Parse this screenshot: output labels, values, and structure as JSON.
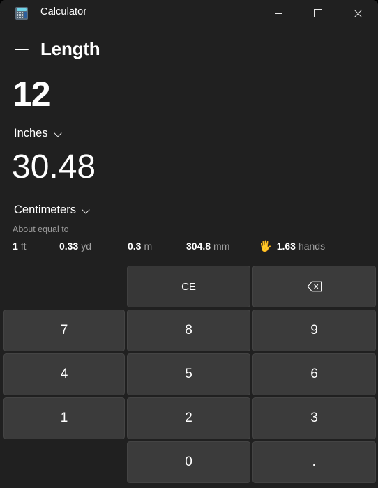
{
  "window": {
    "title": "Calculator",
    "app_icon": "calculator-icon",
    "controls": {
      "minimize": "minimize-icon",
      "maximize": "maximize-icon",
      "close": "close-icon"
    }
  },
  "header": {
    "menu_icon": "hamburger-menu-icon",
    "mode_title": "Length"
  },
  "converter": {
    "from": {
      "value": "12",
      "unit": "Inches",
      "chevron": "chevron-down-icon"
    },
    "to": {
      "value": "30.48",
      "unit": "Centimeters",
      "chevron": "chevron-down-icon"
    },
    "about_label": "About equal to",
    "equivalents": [
      {
        "number": "1",
        "unit": "ft",
        "icon": ""
      },
      {
        "number": "0.33",
        "unit": "yd",
        "icon": ""
      },
      {
        "number": "0.3",
        "unit": "m",
        "icon": ""
      },
      {
        "number": "304.8",
        "unit": "mm",
        "icon": ""
      },
      {
        "number": "1.63",
        "unit": "hands",
        "icon": "raised-hand-icon",
        "glyph": "🖐"
      }
    ]
  },
  "keypad": {
    "rows": [
      [
        {
          "kind": "empty",
          "label": "",
          "name": "key-empty-top-left"
        },
        {
          "kind": "func",
          "label": "CE",
          "name": "clear-entry-button"
        },
        {
          "kind": "icon",
          "label": "",
          "name": "backspace-button",
          "icon": "backspace-icon"
        }
      ],
      [
        {
          "kind": "digit",
          "label": "7",
          "name": "key-7"
        },
        {
          "kind": "digit",
          "label": "8",
          "name": "key-8"
        },
        {
          "kind": "digit",
          "label": "9",
          "name": "key-9"
        }
      ],
      [
        {
          "kind": "digit",
          "label": "4",
          "name": "key-4"
        },
        {
          "kind": "digit",
          "label": "5",
          "name": "key-5"
        },
        {
          "kind": "digit",
          "label": "6",
          "name": "key-6"
        }
      ],
      [
        {
          "kind": "digit",
          "label": "1",
          "name": "key-1"
        },
        {
          "kind": "digit",
          "label": "2",
          "name": "key-2"
        },
        {
          "kind": "digit",
          "label": "3",
          "name": "key-3"
        }
      ],
      [
        {
          "kind": "empty",
          "label": "",
          "name": "key-empty-bottom-left"
        },
        {
          "kind": "digit",
          "label": "0",
          "name": "key-0"
        },
        {
          "kind": "dot",
          "label": ".",
          "name": "key-decimal"
        }
      ]
    ]
  },
  "colors": {
    "window_background": "#202020",
    "content_background": "#1f1f1f",
    "key_fill": "#3b3b3b",
    "key_border": "#444444",
    "text_primary": "#ffffff",
    "text_secondary": "#9a9a9a",
    "close_hover": "#c42b1c",
    "icon_accent": "#6fd4e8"
  }
}
